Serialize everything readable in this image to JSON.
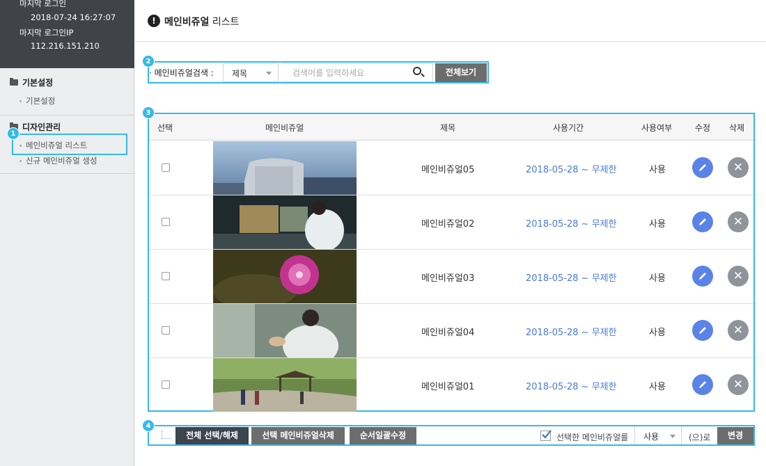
{
  "sidebar": {
    "last_login_label": "마지막 로그인",
    "last_login_value": "2018-07-24 16:27:07",
    "last_ip_label": "마지막 로그인IP",
    "last_ip_value": "112.216.151.210",
    "sections": [
      {
        "title": "기본설정",
        "items": [
          "기본설정"
        ]
      },
      {
        "title": "디자인관리",
        "items": [
          "메인비쥬얼 리스트",
          "신규 메인비쥬얼 생성"
        ]
      }
    ]
  },
  "annotations": [
    "1",
    "2",
    "3",
    "4"
  ],
  "header": {
    "icon": "!",
    "title_bold": "메인비쥬얼",
    "title_rest": " 리스트"
  },
  "search": {
    "label": "· 메인비쥬얼검색 :",
    "field_value": "제목",
    "placeholder": "검색어를 입력하세요",
    "view_all": "전체보기"
  },
  "table": {
    "headers": [
      "선택",
      "메인비쥬얼",
      "제목",
      "사용기간",
      "사용여부",
      "수정",
      "삭제"
    ],
    "rows": [
      {
        "title": "메인비쥬얼05",
        "period": "2018-05-28 ~ 무제한",
        "status": "사용",
        "thumb": "building-sky"
      },
      {
        "title": "메인비쥬얼02",
        "period": "2018-05-28 ~ 무제한",
        "status": "사용",
        "thumb": "lab-researcher"
      },
      {
        "title": "메인비쥬얼03",
        "period": "2018-05-28 ~ 무제한",
        "status": "사용",
        "thumb": "pink-flower"
      },
      {
        "title": "메인비쥬얼04",
        "period": "2018-05-28 ~ 무제한",
        "status": "사용",
        "thumb": "scientist-seeds"
      },
      {
        "title": "메인비쥬얼01",
        "period": "2018-05-28 ~ 무제한",
        "status": "사용",
        "thumb": "park-walkers"
      }
    ]
  },
  "footer": {
    "select_all": "전체 선택/해제",
    "delete_selected": "선택 메인비쥬얼삭제",
    "reorder": "순서일괄수정",
    "selected_label": "선택한 메인비쥬얼를",
    "status_value": "사용",
    "suffix": "(으)로",
    "change": "변경"
  },
  "colors": {
    "accent": "#36b9e9",
    "edit": "#5a83e8",
    "delete": "#8f939a",
    "period": "#4a7ad8"
  }
}
